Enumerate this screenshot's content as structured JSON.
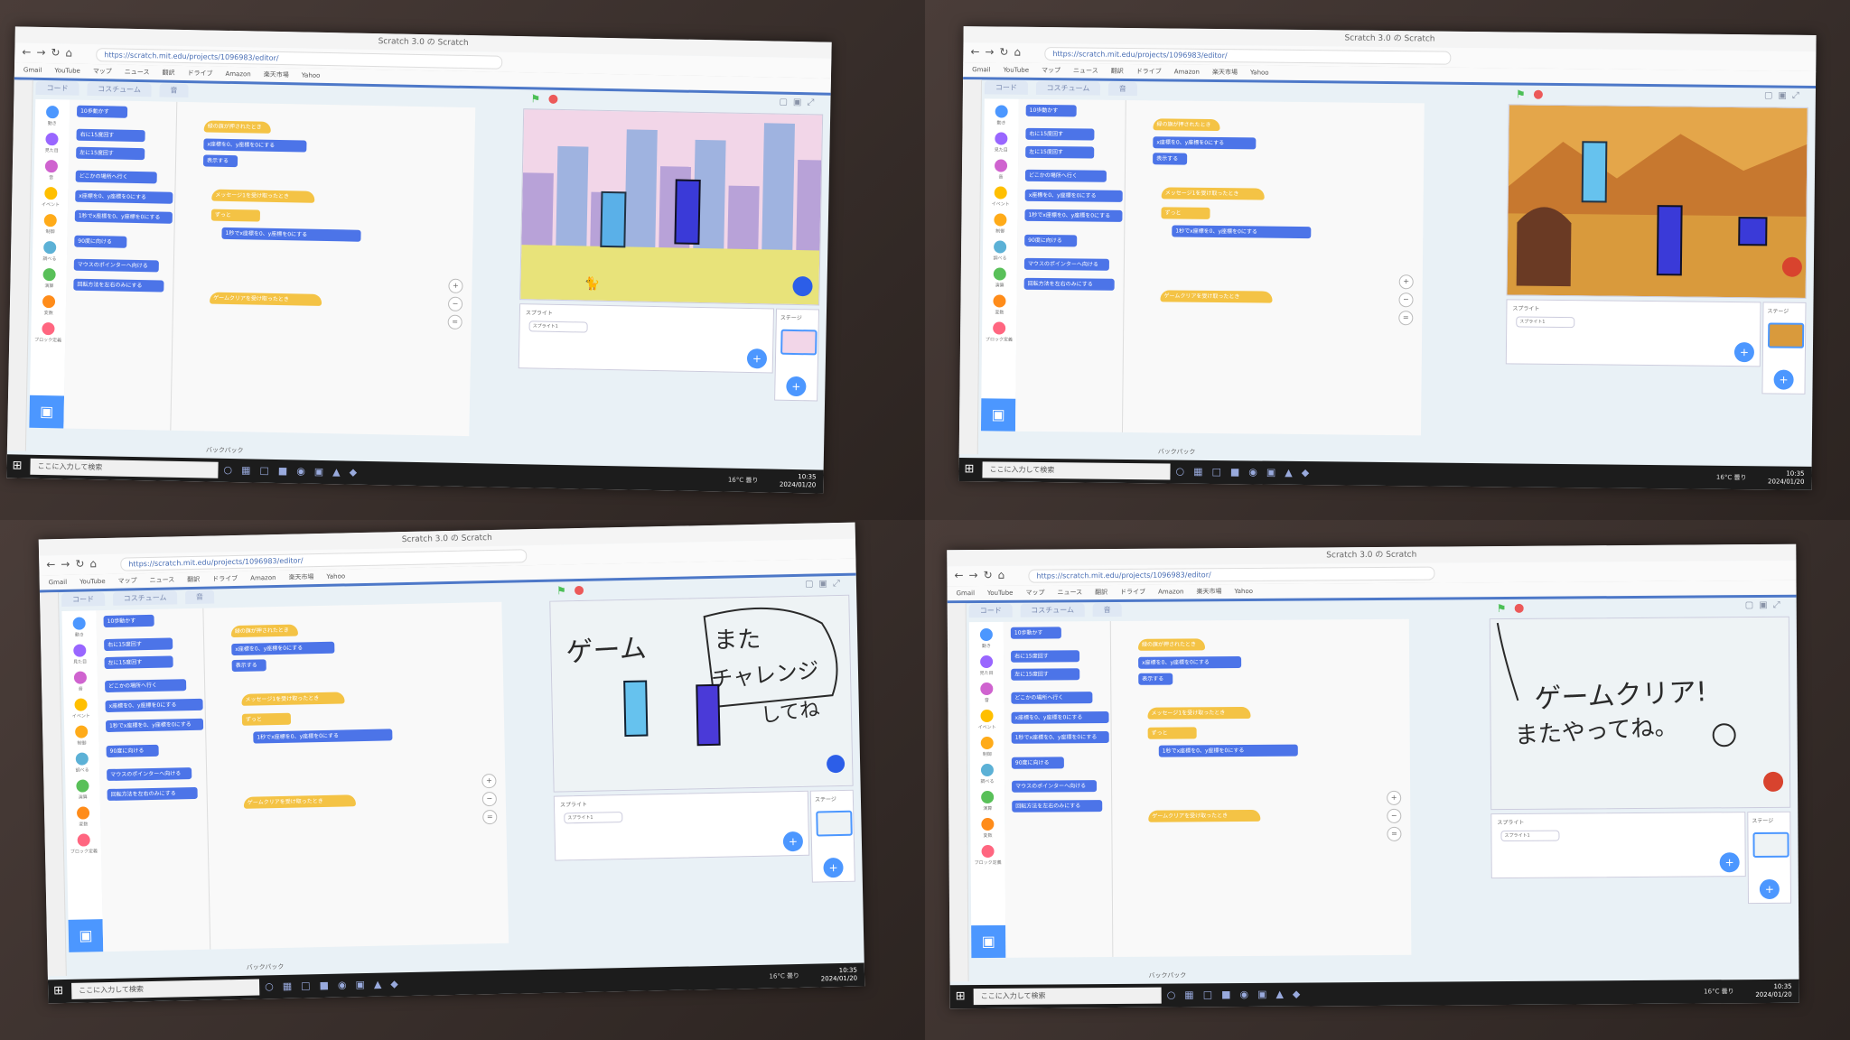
{
  "browser": {
    "title": "Scratch 3.0 の Scratch",
    "url": "https://scratch.mit.edu/projects/1096983/editor/",
    "bookmarks": [
      "Gmail",
      "YouTube",
      "マップ",
      "ニュース",
      "翻訳",
      "ドライブ",
      "Amazon",
      "楽天市場",
      "Yahoo"
    ]
  },
  "editor": {
    "tabs": [
      "コード",
      "コスチューム",
      "音"
    ],
    "categories": [
      {
        "label": "動き",
        "color": "#4c97ff"
      },
      {
        "label": "見た目",
        "color": "#9966ff"
      },
      {
        "label": "音",
        "color": "#cf63cf"
      },
      {
        "label": "イベント",
        "color": "#ffbf00"
      },
      {
        "label": "制御",
        "color": "#ffab19"
      },
      {
        "label": "調べる",
        "color": "#5cb1d6"
      },
      {
        "label": "演算",
        "color": "#59c059"
      },
      {
        "label": "変数",
        "color": "#ff8c1a"
      },
      {
        "label": "ブロック定義",
        "color": "#ff6680"
      }
    ],
    "palette_blocks": [
      "10歩動かす",
      "右に15度回す",
      "左に15度回す",
      "どこかの場所へ行く",
      "x座標を0、y座標を0にする",
      "1秒でx座標を0、y座標を0にする",
      "90度に向ける",
      "マウスのポインターへ向ける",
      "回転方法を左右のみにする"
    ],
    "script_blocks": [
      "緑の旗が押されたとき",
      "x座標を0、y座標を0にする",
      "表示する",
      "メッセージ1を受け取ったとき",
      "ずっと",
      "1秒でx座標を0、y座標を0にする",
      "ゲームクリアを受け取ったとき"
    ],
    "backpack": "バックパック",
    "sprite_panel": {
      "title": "スプライト",
      "name": "スプライト1"
    },
    "stage_panel": {
      "title": "ステージ"
    }
  },
  "taskbar": {
    "search": "ここに入力して検索",
    "weather": "16°C 曇り",
    "time": "10:35",
    "date": "2024/01/20"
  },
  "whiteboards": {
    "retry": {
      "game": "ゲーム",
      "mata": "また",
      "challenge": "チャレンジ",
      "shite": "してね"
    },
    "clear": {
      "line1": "ゲームクリア!",
      "line2": "またやってね。"
    }
  },
  "colors": {
    "block_blue": "#4c74e8",
    "block_yellow": "#f4c345",
    "scratch_blue": "#4c97ff"
  }
}
